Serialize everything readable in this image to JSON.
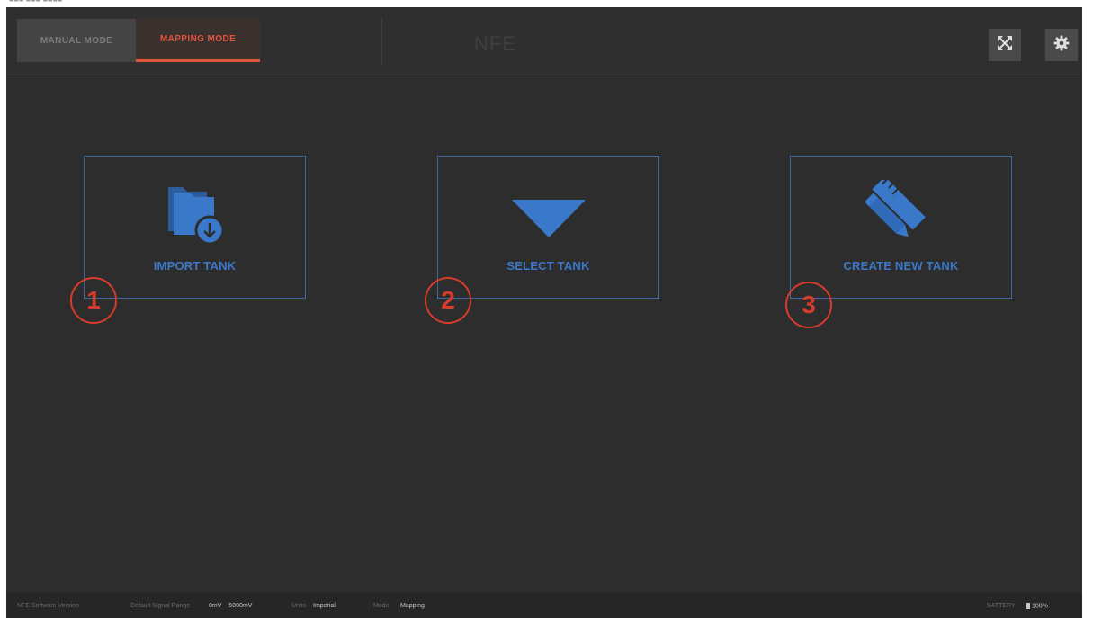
{
  "window": {
    "title": "NFE",
    "clipped_top_text": "■■■ ■■■ ■■■■"
  },
  "header": {
    "tabs": [
      {
        "label": "MANUAL MODE",
        "active": false
      },
      {
        "label": "MAPPING MODE",
        "active": true
      }
    ],
    "buttons": [
      {
        "icon": "expand-arrows-icon"
      },
      {
        "icon": "gear-icon"
      }
    ]
  },
  "cards": [
    {
      "label": "IMPORT TANK",
      "icon": "folder-download-icon",
      "step": "1"
    },
    {
      "label": "SELECT TANK",
      "icon": "triangle-down-icon",
      "step": "2"
    },
    {
      "label": "CREATE NEW TANK",
      "icon": "pencil-ruler-icon",
      "step": "3"
    }
  ],
  "status_bar": {
    "software_version_label": "NFE Software Version",
    "signal_range_label": "Default Signal Range",
    "signal_range_value": "0mV ~ 5000mV",
    "units_label": "Units",
    "units_value": "Imperial",
    "mode_label": "Mode",
    "mode_value": "Mapping",
    "battery_label": "BATTERY",
    "battery_value": "100%"
  },
  "colors": {
    "background": "#2d2d2d",
    "accent_blue": "#3a78c9",
    "active_tab_orange": "#e0533c",
    "annotation_red": "#d63b2b"
  }
}
